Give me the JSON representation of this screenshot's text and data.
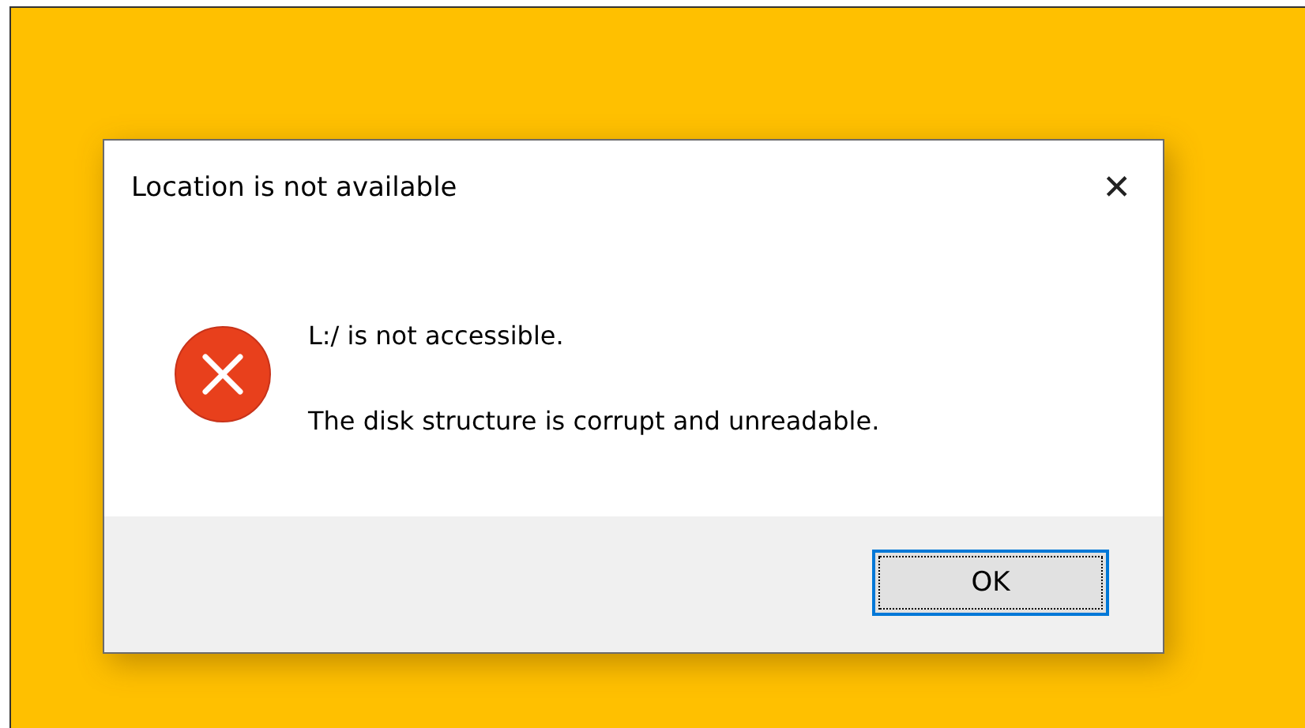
{
  "dialog": {
    "title": "Location is not available",
    "close": "✕",
    "messages": [
      "L:/ is not accessible.",
      "The disk structure is corrupt and unreadable."
    ],
    "buttons": [
      {
        "label": "OK",
        "focused": true
      }
    ]
  }
}
